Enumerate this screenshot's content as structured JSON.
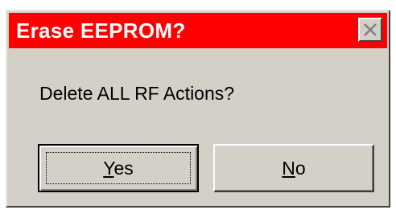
{
  "dialog": {
    "title": "Erase EEPROM?",
    "message": "Delete ALL RF Actions?",
    "buttons": {
      "yes": {
        "mnemonic": "Y",
        "rest": "es"
      },
      "no": {
        "mnemonic": "N",
        "rest": "o"
      }
    },
    "close_icon": "close-x-icon",
    "colors": {
      "titlebar": "#ff0000",
      "title_text": "#ffffff",
      "face": "#d4d0c8"
    }
  }
}
